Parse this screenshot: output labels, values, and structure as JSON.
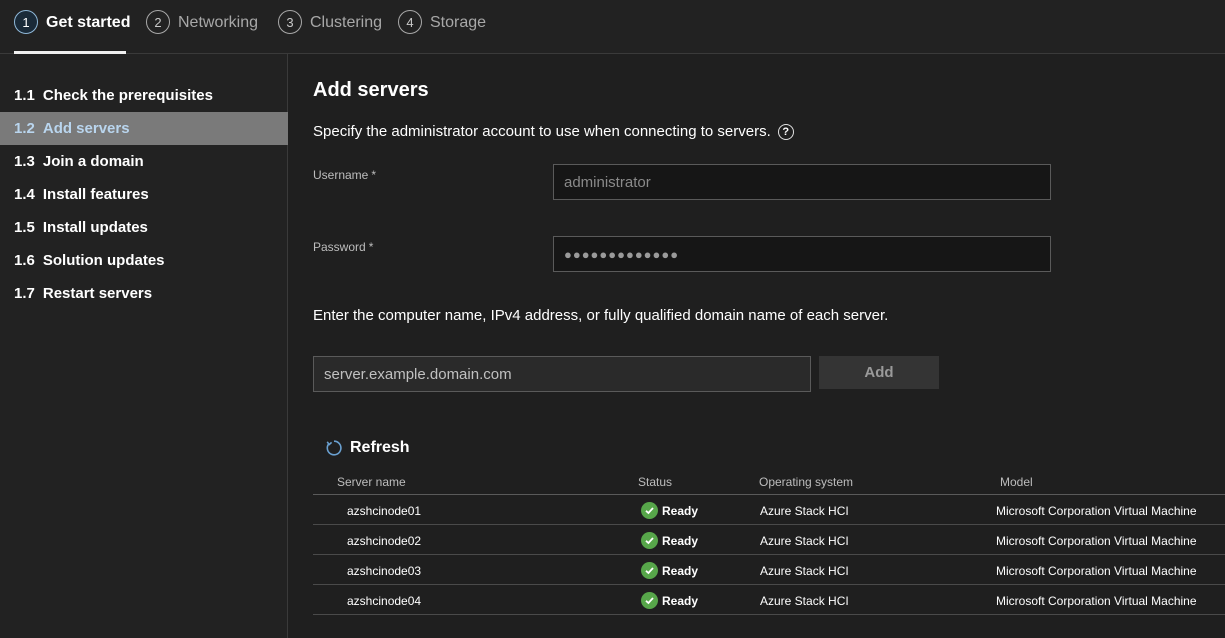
{
  "stepper": {
    "steps": [
      {
        "num": "1",
        "label": "Get started"
      },
      {
        "num": "2",
        "label": "Networking"
      },
      {
        "num": "3",
        "label": "Clustering"
      },
      {
        "num": "4",
        "label": "Storage"
      }
    ]
  },
  "sidebar": {
    "items": [
      {
        "num": "1.1",
        "label": "Check the prerequisites"
      },
      {
        "num": "1.2",
        "label": "Add servers"
      },
      {
        "num": "1.3",
        "label": "Join a domain"
      },
      {
        "num": "1.4",
        "label": "Install features"
      },
      {
        "num": "1.5",
        "label": "Install updates"
      },
      {
        "num": "1.6",
        "label": "Solution updates"
      },
      {
        "num": "1.7",
        "label": "Restart servers"
      }
    ]
  },
  "main": {
    "title": "Add servers",
    "description": "Specify the administrator account to use when connecting to servers.",
    "help_glyph": "?",
    "username_label": "Username",
    "password_label": "Password",
    "required_mark": "*",
    "username_value": "administrator",
    "password_value": "●●●●●●●●●●●●●",
    "server_description": "Enter the computer name, IPv4 address, or fully qualified domain name of each server.",
    "server_input_value": "server.example.domain.com",
    "add_label": "Add",
    "refresh_label": "Refresh"
  },
  "table": {
    "headers": [
      "Server name",
      "Status",
      "Operating system",
      "Model"
    ],
    "rows": [
      {
        "name": "azshcinode01",
        "status": "Ready",
        "os": "Azure Stack HCI",
        "model": "Microsoft Corporation Virtual Machine"
      },
      {
        "name": "azshcinode02",
        "status": "Ready",
        "os": "Azure Stack HCI",
        "model": "Microsoft Corporation Virtual Machine"
      },
      {
        "name": "azshcinode03",
        "status": "Ready",
        "os": "Azure Stack HCI",
        "model": "Microsoft Corporation Virtual Machine"
      },
      {
        "name": "azshcinode04",
        "status": "Ready",
        "os": "Azure Stack HCI",
        "model": "Microsoft Corporation Virtual Machine"
      }
    ]
  },
  "icons": {
    "status_ok": "checkmark-circle-icon",
    "refresh": "refresh-icon",
    "help": "help-circle-icon"
  },
  "colors": {
    "accent": "#b9d5ee",
    "status_ok": "#57a64a",
    "selected_bg": "#7a7a7a"
  }
}
